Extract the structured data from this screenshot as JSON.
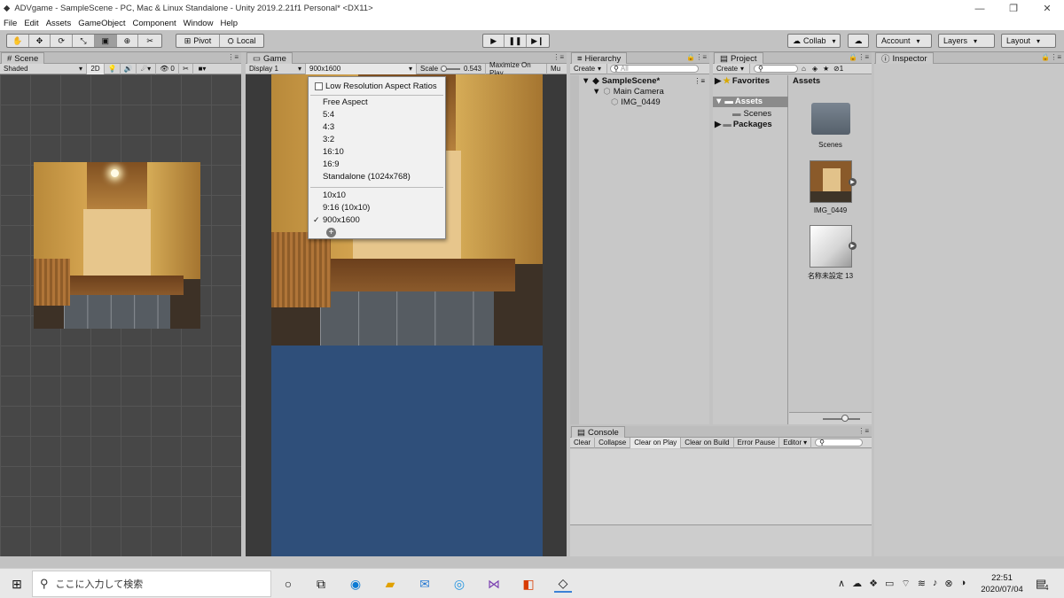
{
  "window": {
    "title": "ADVgame - SampleScene - PC, Mac & Linux Standalone - Unity 2019.2.21f1 Personal* <DX11>"
  },
  "menu": [
    "File",
    "Edit",
    "Assets",
    "GameObject",
    "Component",
    "Window",
    "Help"
  ],
  "toolbar": {
    "pivot": "Pivot",
    "local": "Local",
    "collab": "Collab",
    "account": "Account",
    "layers": "Layers",
    "layout": "Layout"
  },
  "scene": {
    "tab": "Scene",
    "shading": "Shaded",
    "mode2d": "2D",
    "gizmo_count": "0"
  },
  "game": {
    "tab": "Game",
    "display": "Display 1",
    "resolution": "900x1600",
    "scale_label": "Scale",
    "scale_value": "0.543",
    "maximize": "Maximize On Play",
    "mute": "Mu"
  },
  "aspect_menu": {
    "low_res": "Low Resolution Aspect Ratios",
    "options": [
      "Free Aspect",
      "5:4",
      "4:3",
      "3:2",
      "16:10",
      "16:9",
      "Standalone (1024x768)"
    ],
    "custom": [
      "10x10",
      "9:16 (10x10)",
      "900x1600"
    ],
    "selected": "900x1600",
    "add": "+",
    "check": "✓"
  },
  "hierarchy": {
    "tab": "Hierarchy",
    "create": "Create",
    "search_placeholder": "All",
    "scene": "SampleScene*",
    "items": [
      "Main Camera",
      "IMG_0449"
    ]
  },
  "project": {
    "tab": "Project",
    "create": "Create",
    "favorites": "Favorites",
    "assets": "Assets",
    "scenes": "Scenes",
    "packages": "Packages",
    "header": "Assets",
    "files": [
      "Scenes",
      "IMG_0449",
      "名称未設定 13"
    ],
    "zoom": 0.6
  },
  "inspector": {
    "tab": "Inspector"
  },
  "console": {
    "tab": "Console",
    "buttons": [
      "Clear",
      "Collapse",
      "Clear on Play",
      "Clear on Build",
      "Error Pause",
      "Editor"
    ]
  },
  "taskbar": {
    "search": "ここに入力して検索",
    "time": "22:51",
    "date": "2020/07/04",
    "notif_count": "4"
  },
  "colors": {
    "game_blue": "#2f4f7a",
    "selection": "#8b8b8b"
  }
}
